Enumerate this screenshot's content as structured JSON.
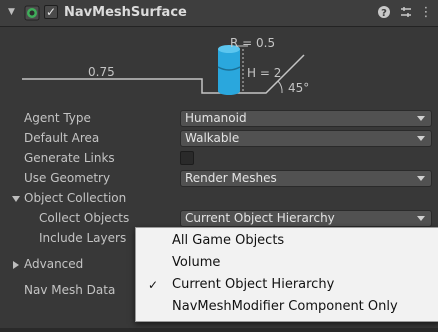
{
  "header": {
    "title": "NavMeshSurface",
    "enabled": "✓",
    "icons": [
      "fold-arrow-icon",
      "navmesh-component-icon",
      "help-icon",
      "preset-icon",
      "more-options-icon"
    ]
  },
  "diagram": {
    "radius_label": "R = 0.5",
    "height_label": "H = 2",
    "step_label": "0.75",
    "slope_label": "45°",
    "agent_color": "#2aa7dd"
  },
  "properties": {
    "agent_type": {
      "label": "Agent Type",
      "value": "Humanoid"
    },
    "default_area": {
      "label": "Default Area",
      "value": "Walkable"
    },
    "generate_links": {
      "label": "Generate Links",
      "checked": false
    },
    "use_geometry": {
      "label": "Use Geometry",
      "value": "Render Meshes"
    },
    "object_collection": {
      "label": "Object Collection",
      "collect_objects": {
        "label": "Collect Objects",
        "value": "Current Object Hierarchy"
      },
      "include_layers": {
        "label": "Include Layers"
      }
    },
    "advanced": {
      "label": "Advanced"
    },
    "nav_mesh_data": {
      "label": "Nav Mesh Data"
    }
  },
  "popup": {
    "items": [
      {
        "label": "All Game Objects",
        "check": ""
      },
      {
        "label": "Volume",
        "check": ""
      },
      {
        "label": "Current Object Hierarchy",
        "check": "✓"
      },
      {
        "label": "NavMeshModifier Component Only",
        "check": ""
      }
    ]
  }
}
